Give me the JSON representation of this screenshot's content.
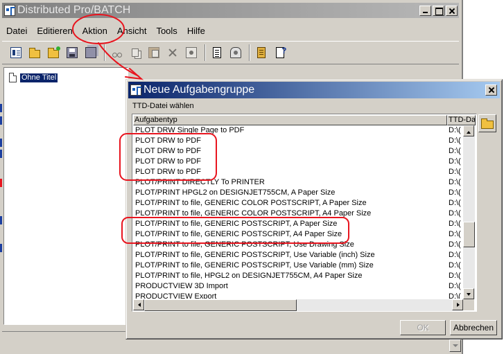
{
  "main_window": {
    "title": "Distributed Pro/BATCH",
    "menu": [
      "Datei",
      "Editieren",
      "Aktion",
      "Ansicht",
      "Tools",
      "Hilfe"
    ],
    "toolbar_icons": [
      "properties-icon",
      "open-folder-icon",
      "open-folder-green-icon",
      "save-icon",
      "save-all-icon",
      "cut-icon",
      "copy-icon",
      "paste-icon",
      "delete-icon",
      "group-properties-icon",
      "document-icon",
      "globe-icon",
      "stack-icon",
      "help-document-icon"
    ],
    "tree_item": "Ohne Titel"
  },
  "dialog": {
    "title": "Neue Aufgabengruppe",
    "section_label": "TTD-Datei wählen",
    "columns": [
      "Aufgabentyp",
      "TTD-Da"
    ],
    "rows": [
      {
        "type": "PLOT DRW Single Page to PDF",
        "file": "D:\\("
      },
      {
        "type": "PLOT DRW to PDF",
        "file": "D:\\("
      },
      {
        "type": "PLOT DRW to PDF",
        "file": "D:\\("
      },
      {
        "type": "PLOT DRW to PDF",
        "file": "D:\\("
      },
      {
        "type": "PLOT DRW to PDF",
        "file": "D:\\("
      },
      {
        "type": "PLOT/PRINT DIRECTLY To PRINTER",
        "file": "D:\\("
      },
      {
        "type": "PLOT/PRINT HPGL2 on DESIGNJET755CM, A Paper Size",
        "file": "D:\\("
      },
      {
        "type": "PLOT/PRINT to file, GENERIC COLOR POSTSCRIPT, A Paper Size",
        "file": "D:\\("
      },
      {
        "type": "PLOT/PRINT to file, GENERIC COLOR POSTSCRIPT, A4 Paper Size",
        "file": "D:\\("
      },
      {
        "type": "PLOT/PRINT to file, GENERIC POSTSCRIPT, A Paper Size",
        "file": "D:\\("
      },
      {
        "type": "PLOT/PRINT to file, GENERIC POSTSCRIPT, A4 Paper Size",
        "file": "D:\\("
      },
      {
        "type": "PLOT/PRINT to file, GENERIC POSTSCRIPT, Use Drawing Size",
        "file": "D:\\("
      },
      {
        "type": "PLOT/PRINT to file, GENERIC POSTSCRIPT, Use Variable (inch) Size",
        "file": "D:\\("
      },
      {
        "type": "PLOT/PRINT to file, GENERIC POSTSCRIPT, Use Variable (mm) Size",
        "file": "D:\\("
      },
      {
        "type": "PLOT/PRINT to file, HPGL2 on DESIGNJET755CM, A4 Paper Size",
        "file": "D:\\("
      },
      {
        "type": "PRODUCTVIEW 3D Import",
        "file": "D:\\("
      },
      {
        "type": "PRODUCTVIEW Export",
        "file": "D:\\("
      }
    ],
    "ok_label": "OK",
    "cancel_label": "Abbrechen"
  },
  "colors": {
    "annotation_red": "#e8141e",
    "dialog_title_start": "#0a246a",
    "dialog_title_end": "#a6caf0",
    "inactive_title_start": "#808080",
    "selection": "#0a246a",
    "face": "#d4d0c8"
  }
}
